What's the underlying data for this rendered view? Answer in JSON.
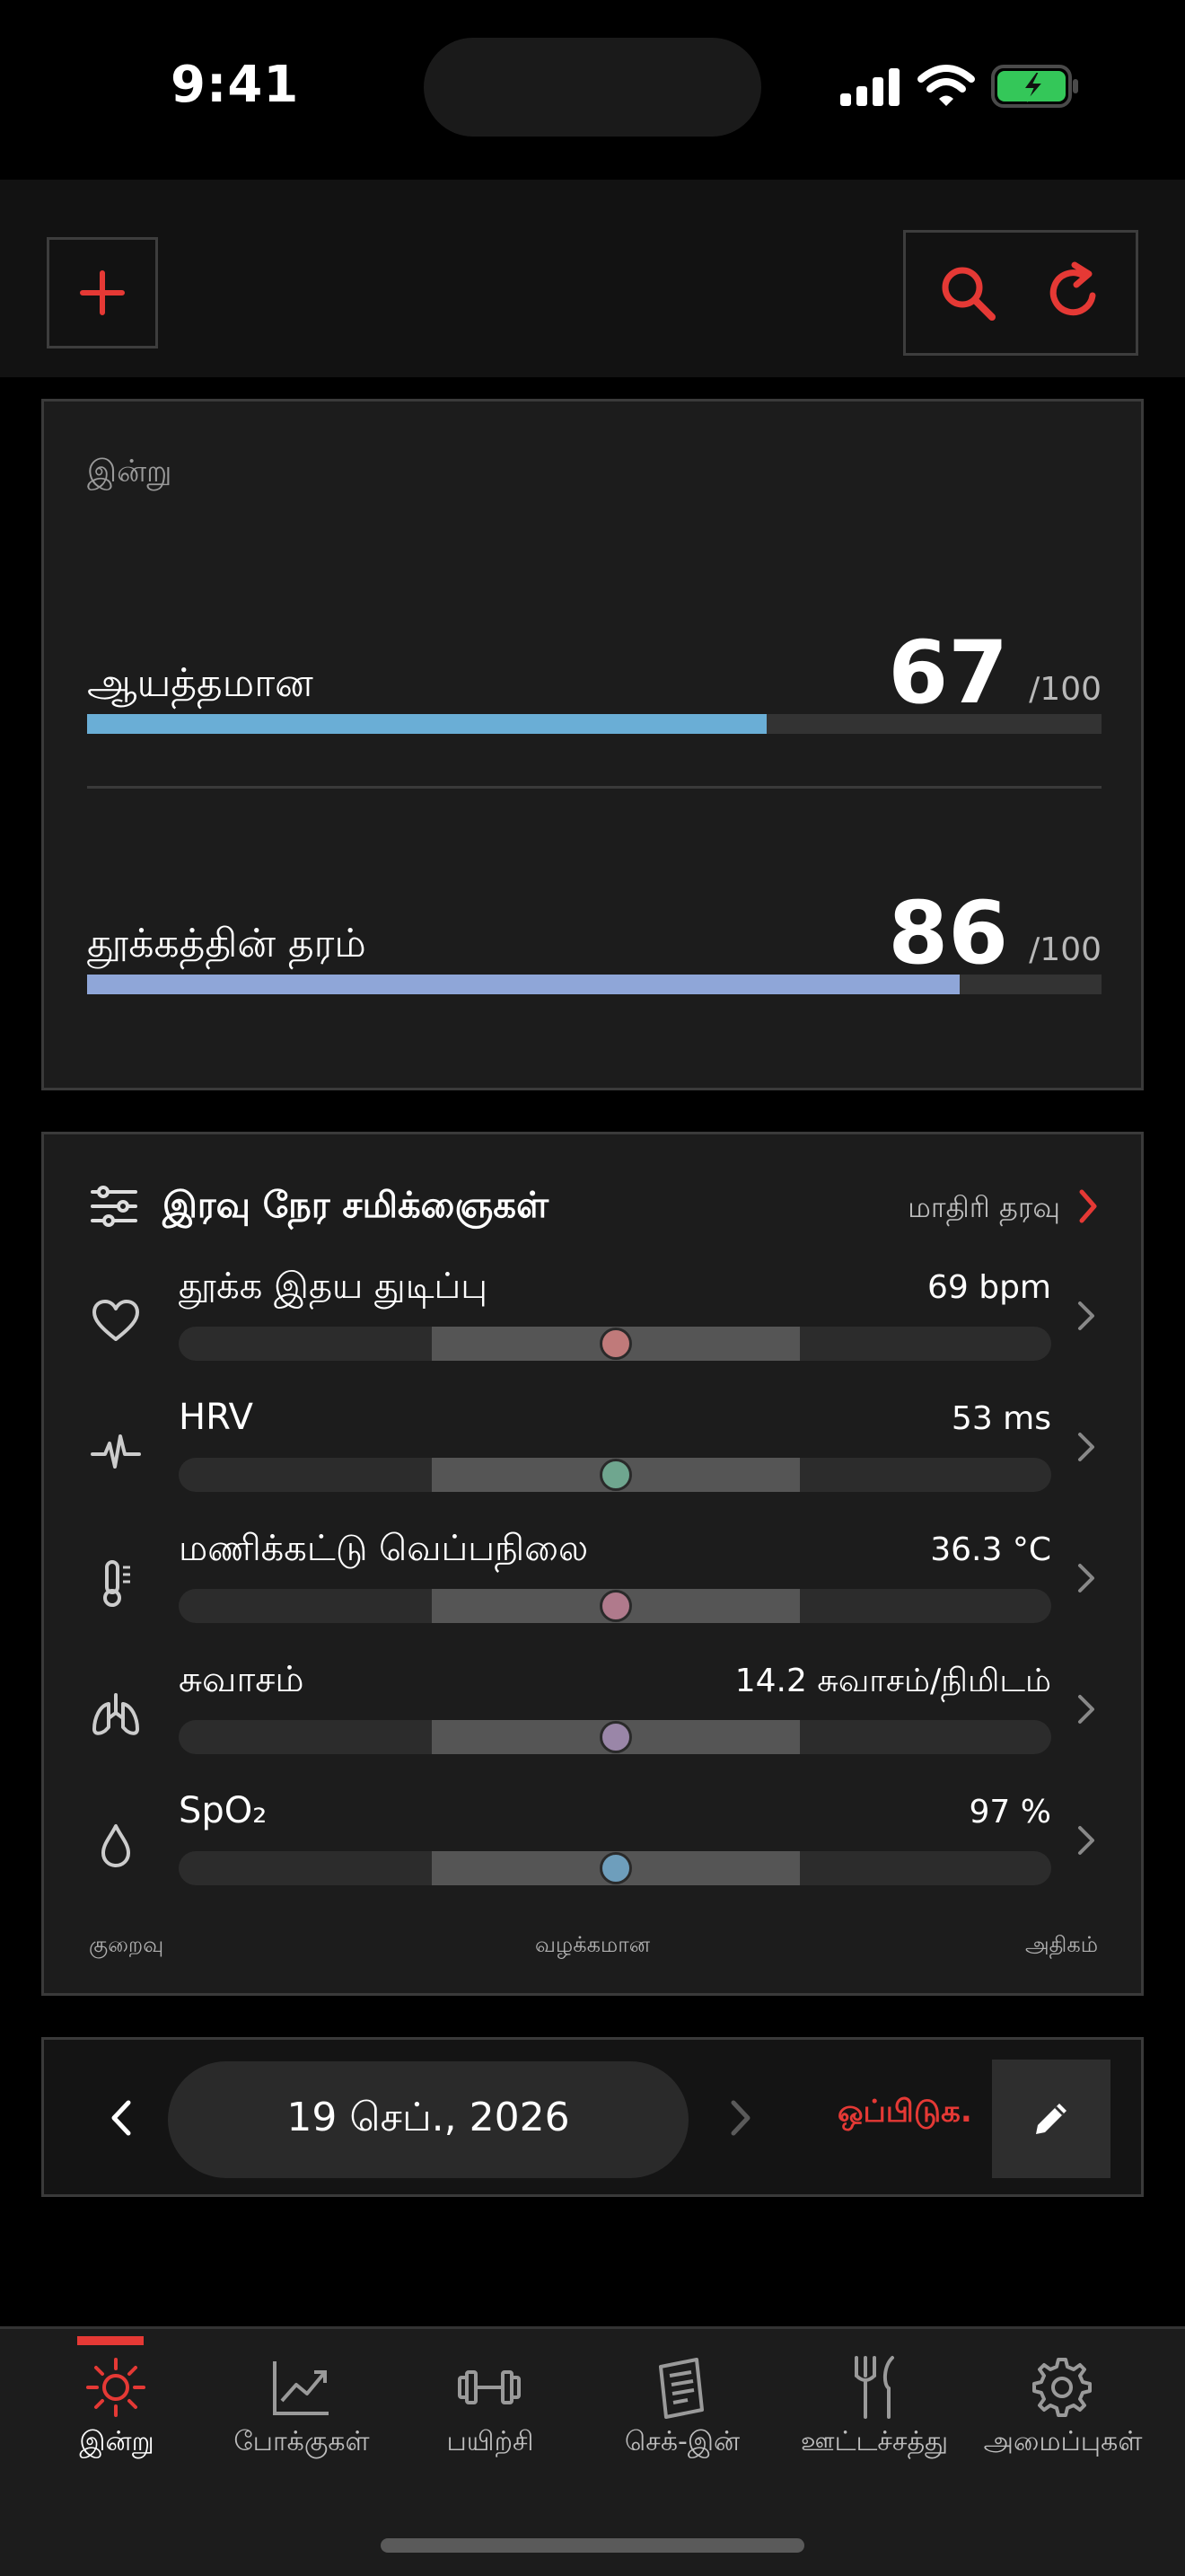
{
  "status_bar": {
    "time": "9:41"
  },
  "today": {
    "label": "இன்று",
    "readiness": {
      "name": "ஆயத்தமான",
      "value": "67",
      "max": "/100",
      "fraction": 0.67,
      "color": "#6aaed6"
    },
    "sleep": {
      "name": "தூக்கத்தின் தரம்",
      "value": "86",
      "max": "/100",
      "fraction": 0.86,
      "color": "#8fa6d8"
    }
  },
  "nightly": {
    "title": "இரவு நேர சமிக்ஞைகள்",
    "sample_link": "மாதிரி தரவு",
    "metrics": [
      {
        "name": "தூக்க இதய துடிப்பு",
        "value": "69 bpm",
        "icon": "heart-icon",
        "position": 0.5,
        "color": "#c07a7a"
      },
      {
        "name": "HRV",
        "value": "53 ms",
        "icon": "pulse-icon",
        "position": 0.5,
        "color": "#6fa68f"
      },
      {
        "name": "மணிக்கட்டு வெப்பநிலை",
        "value": "36.3 °C",
        "icon": "thermometer-icon",
        "position": 0.5,
        "color": "#b07a8c"
      },
      {
        "name": "சுவாசம்",
        "value": "14.2 சுவாசம்/நிமிடம்",
        "icon": "lungs-icon",
        "position": 0.5,
        "color": "#9a86a8"
      },
      {
        "name": "SpO₂",
        "value": "97 %",
        "icon": "droplet-icon",
        "position": 0.5,
        "color": "#6e9ebc"
      }
    ],
    "legend": {
      "low": "குறைவு",
      "normal": "வழக்கமான",
      "high": "அதிகம்"
    }
  },
  "date_nav": {
    "date": "19 செப்., 2026",
    "compare": "ஒப்பிடுக."
  },
  "tabs": [
    {
      "label": "இன்று",
      "icon": "sun-icon",
      "active": true
    },
    {
      "label": "போக்குகள்",
      "icon": "trend-chart-icon",
      "active": false
    },
    {
      "label": "பயிற்சி",
      "icon": "dumbbell-icon",
      "active": false
    },
    {
      "label": "செக்-இன்",
      "icon": "journal-icon",
      "active": false
    },
    {
      "label": "ஊட்டச்சத்து",
      "icon": "fork-knife-icon",
      "active": false
    },
    {
      "label": "அமைப்புகள்",
      "icon": "gear-icon",
      "active": false
    }
  ],
  "colors": {
    "accent": "#e53935",
    "card": "#1c1c1c",
    "border": "#3a3a3a"
  }
}
